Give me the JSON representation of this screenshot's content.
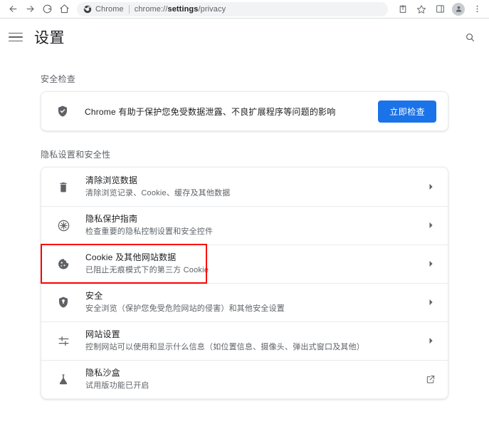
{
  "browser": {
    "nav": {
      "back_label": "Back",
      "forward_label": "Forward",
      "reload_label": "Reload",
      "home_label": "Home"
    },
    "omnibox": {
      "chip_label": "Chrome",
      "url_prefix": "chrome://",
      "url_bold": "settings",
      "url_suffix": "/privacy",
      "full_url": "chrome://settings/privacy"
    },
    "toolbar": {
      "share_label": "Share this page",
      "bookmark_label": "Bookmark this tab",
      "side_panel_label": "Side panel",
      "profile_label": "Profile",
      "menu_label": "Customize and control Google Chrome"
    }
  },
  "settings": {
    "menu_label": "主菜单",
    "title": "设置",
    "search_label": "搜索设置"
  },
  "safety_check": {
    "section_title": "安全检查",
    "description": "Chrome 有助于保护您免受数据泄露、不良扩展程序等问题的影响",
    "button_label": "立即检查",
    "button_color": "#1a73e8",
    "icon": "shield-check-icon"
  },
  "privacy": {
    "section_title": "隐私设置和安全性",
    "rows": [
      {
        "icon": "trash-icon",
        "title": "清除浏览数据",
        "subtitle": "清除浏览记录、Cookie、缓存及其他数据",
        "action": "chevron-right-icon"
      },
      {
        "icon": "privacy-guide-icon",
        "title": "隐私保护指南",
        "subtitle": "检查重要的隐私控制设置和安全控件",
        "action": "chevron-right-icon"
      },
      {
        "icon": "cookie-icon",
        "title": "Cookie 及其他网站数据",
        "subtitle": "已阻止无痕模式下的第三方 Cookie",
        "action": "chevron-right-icon",
        "highlighted": true
      },
      {
        "icon": "shield-icon",
        "title": "安全",
        "subtitle": "安全浏览（保护您免受危险网站的侵害）和其他安全设置",
        "action": "chevron-right-icon"
      },
      {
        "icon": "tune-icon",
        "title": "网站设置",
        "subtitle": "控制网站可以使用和显示什么信息（如位置信息、摄像头、弹出式窗口及其他）",
        "action": "chevron-right-icon"
      },
      {
        "icon": "flask-icon",
        "title": "隐私沙盒",
        "subtitle": "试用版功能已开启",
        "action": "open-in-new-icon"
      }
    ]
  },
  "annotation": {
    "highlight_color": "#ff0000",
    "target_row_index": 2
  }
}
